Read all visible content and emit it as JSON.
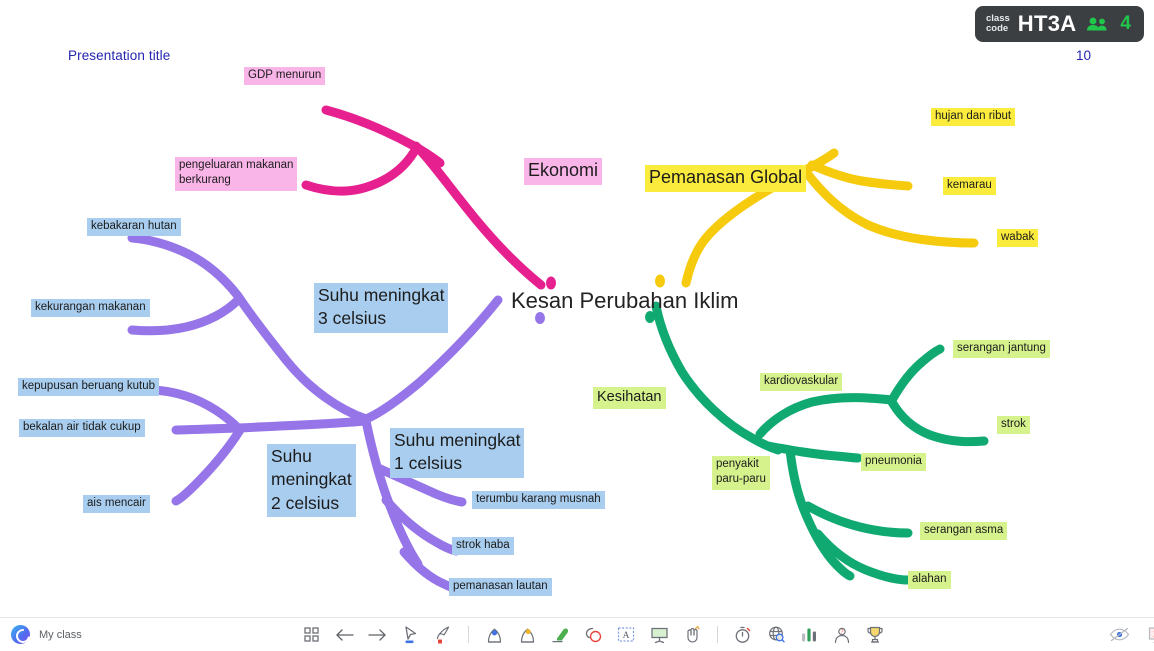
{
  "presentation": {
    "title": "Presentation title",
    "slide_number": "10",
    "center_title": "Kesan Perubahan Iklim"
  },
  "class_badge": {
    "label_line1": "class",
    "label_line2": "code",
    "code": "HT3A",
    "participants": "4",
    "people_icon": "people-icon",
    "background": "#3c3f42",
    "count_color": "#21c74a"
  },
  "mindmap": {
    "branches": [
      {
        "name": "Ekonomi",
        "stroke_color": "#e6218f",
        "highlight": "#f9b4e8",
        "root_label": "Ekonomi",
        "children": [
          "GDP menurun",
          "pengeluaran makanan berkurang"
        ]
      },
      {
        "name": "Pemanasan Global",
        "stroke_color": "#f6ca0d",
        "highlight": "#fbeb3c",
        "root_label": "Pemanasan Global",
        "children": [
          "hujan dan ribut",
          "kemarau",
          "wabak"
        ]
      },
      {
        "name": "Kesihatan",
        "stroke_color": "#10a971",
        "highlight": "#d6f28d",
        "root_label": "Kesihatan",
        "children": [
          {
            "label": "kardiovaskular",
            "children": [
              "serangan jantung",
              "strok"
            ]
          },
          {
            "label": "penyakit paru-paru",
            "children": [
              "pneumonia",
              "serangan asma",
              "alahan"
            ]
          }
        ]
      },
      {
        "name": "Suhu meningkat",
        "stroke_color": "#9575e8",
        "highlight": "#a8cdee",
        "children": [
          {
            "label": "Suhu meningkat\n3 celsius",
            "children": [
              "kebakaran hutan",
              "kekurangan makanan"
            ]
          },
          {
            "label": "Suhu meningkat\n2 celsius",
            "children": [
              "kepupusan beruang kutub",
              "bekalan air tidak cukup",
              "ais mencair"
            ]
          },
          {
            "label": "Suhu meningkat\n1 celsius",
            "children": [
              "terumbu karang musnah",
              "strok haba",
              "pemanasan lautan"
            ]
          }
        ]
      }
    ],
    "nodes": {
      "gdp_menurun": "GDP menurun",
      "pengeluaran_makanan": "pengeluaran makanan\nberkurang",
      "ekonomi": "Ekonomi",
      "hujan_dan_ribut": "hujan dan ribut",
      "pemanasan_global": "Pemanasan Global",
      "kemarau": "kemarau",
      "wabak": "wabak",
      "kebakaran_hutan": "kebakaran hutan",
      "kekurangan_makanan": "kekurangan makanan",
      "suhu_3": "Suhu meningkat\n3 celsius",
      "kepupusan_beruang": "kepupusan beruang kutub",
      "bekalan_air": "bekalan air tidak cukup",
      "ais_mencair": "ais mencair",
      "suhu_2": "Suhu\nmeningkat\n2 celsius",
      "suhu_1": "Suhu meningkat\n1 celsius",
      "terumbu_karang": "terumbu karang musnah",
      "strok_haba": "strok haba",
      "pemanasan_lautan": "pemanasan lautan",
      "kesihatan": "Kesihatan",
      "kardiovaskular": "kardiovaskular",
      "serangan_jantung": "serangan jantung",
      "strok": "strok",
      "penyakit_paru": "penyakit\nparu-paru",
      "pneumonia": "pneumonia",
      "serangan_asma": "serangan asma",
      "alahan": "alahan"
    }
  },
  "toolbar": {
    "brand_label": "My class",
    "brand_icon": "classpoint-logo-icon",
    "tools": [
      {
        "icon": "grid-icon",
        "name": "slide-overview"
      },
      {
        "icon": "arrow-left-icon",
        "name": "previous-slide"
      },
      {
        "icon": "arrow-right-icon",
        "name": "next-slide"
      },
      {
        "icon": "cursor-select-icon",
        "name": "select-tool"
      },
      {
        "icon": "laser-pointer-icon",
        "name": "laser-pointer-tool"
      },
      {
        "icon": "pen-icon",
        "name": "pen-tool"
      },
      {
        "icon": "highlighter-icon",
        "name": "highlighter-tool"
      },
      {
        "icon": "eraser-icon",
        "name": "eraser-tool"
      },
      {
        "icon": "shapes-icon",
        "name": "shapes-tool"
      },
      {
        "icon": "text-box-icon",
        "name": "text-box-tool"
      },
      {
        "icon": "whiteboard-icon",
        "name": "whiteboard-tool"
      },
      {
        "icon": "drag-hand-icon",
        "name": "drag-tool"
      },
      {
        "icon": "timer-icon",
        "name": "timer-tool"
      },
      {
        "icon": "browser-icon",
        "name": "embedded-browser-tool"
      },
      {
        "icon": "bar-chart-icon",
        "name": "poll-tool"
      },
      {
        "icon": "quiz-icon",
        "name": "quiz-tool"
      },
      {
        "icon": "trophy-icon",
        "name": "leaderboard-tool"
      }
    ],
    "right_tools": [
      {
        "icon": "eye-slash-icon",
        "name": "hide-toolbar"
      },
      {
        "icon": "exit-presentation-icon",
        "name": "exit-presentation"
      }
    ]
  }
}
